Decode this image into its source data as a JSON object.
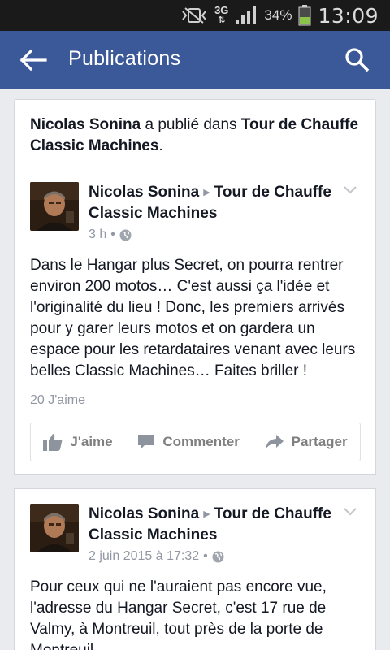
{
  "status_bar": {
    "network": "3G",
    "battery_percent": "34%",
    "time": "13:09"
  },
  "app_bar": {
    "title": "Publications",
    "back_icon": "arrow-left-icon",
    "search_icon": "search-icon"
  },
  "header": {
    "author": "Nicolas Sonina",
    "connector": " a publié dans ",
    "group": "Tour de Chauffe Classic Machines",
    "suffix": "."
  },
  "posts": [
    {
      "author": "Nicolas Sonina",
      "group": "Tour de Chauffe Classic Machines",
      "time": "3 h",
      "separator": "•",
      "text": "Dans le Hangar plus Secret, on pourra rentrer environ 200 motos… C'est aussi ça l'idée et l'originalité du lieu ! Donc, les premiers arrivés pour y garer leurs motos et on gardera un espace pour les retardataires venant avec leurs belles Classic Machines… Faites briller !",
      "likes": "20 J'aime",
      "actions": {
        "like": "J'aime",
        "comment": "Commenter",
        "share": "Partager"
      }
    },
    {
      "author": "Nicolas Sonina",
      "group": "Tour de Chauffe Classic Machines",
      "time": "2 juin 2015 à 17:32",
      "separator": "•",
      "text": "Pour ceux qui ne l'auraient pas encore vue, l'adresse du Hangar Secret, c'est 17 rue de Valmy, à Montreuil, tout près de la porte de Montreuil."
    }
  ],
  "colors": {
    "brand_blue": "#3b5998",
    "background": "#e9ebee",
    "meta_gray": "#9197a3"
  }
}
